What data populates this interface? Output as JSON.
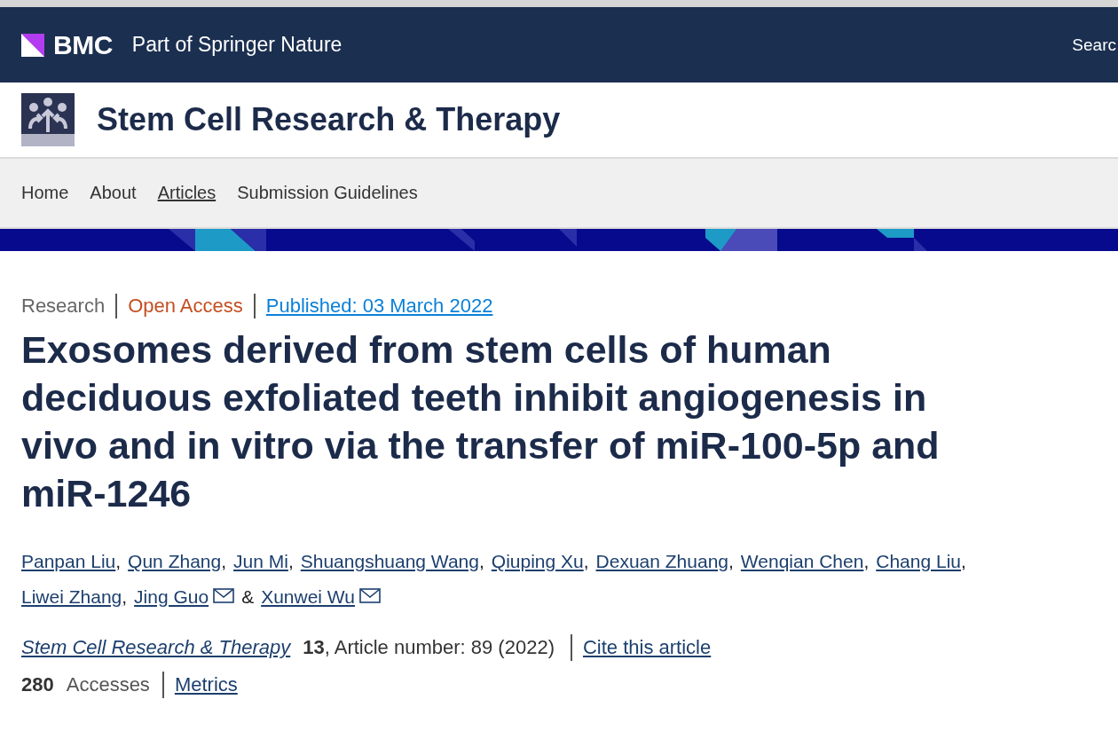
{
  "header": {
    "brand": "BMC",
    "tagline": "Part of Springer Nature",
    "search": "Searc"
  },
  "journal": {
    "title": "Stem Cell Research & Therapy"
  },
  "nav": [
    {
      "label": "Home",
      "selected": false
    },
    {
      "label": "About",
      "selected": false
    },
    {
      "label": "Articles",
      "selected": true
    },
    {
      "label": "Submission Guidelines",
      "selected": false
    }
  ],
  "article": {
    "type": "Research",
    "access": "Open Access",
    "published": "Published: 03 March 2022",
    "title": "Exosomes derived from stem cells of human deciduous exfoliated teeth inhibit angiogenesis in vivo and in vitro via the transfer of miR-100-5p and miR-1246",
    "authors": [
      {
        "name": "Panpan Liu",
        "email": false,
        "sep": ","
      },
      {
        "name": "Qun Zhang",
        "email": false,
        "sep": ","
      },
      {
        "name": "Jun Mi",
        "email": false,
        "sep": ","
      },
      {
        "name": "Shuangshuang Wang",
        "email": false,
        "sep": ","
      },
      {
        "name": "Qiuping Xu",
        "email": false,
        "sep": ","
      },
      {
        "name": "Dexuan Zhuang",
        "email": false,
        "sep": ","
      },
      {
        "name": "Wenqian Chen",
        "email": false,
        "sep": ","
      },
      {
        "name": "Chang Liu",
        "email": false,
        "sep": ","
      },
      {
        "name": "Liwei Zhang",
        "email": false,
        "sep": ","
      },
      {
        "name": "Jing Guo",
        "email": true,
        "sep": "&"
      },
      {
        "name": "Xunwei Wu",
        "email": true
      }
    ],
    "journal_link": "Stem Cell Research & Therapy",
    "volume": "13",
    "article_number": ", Article number: 89 (2022)",
    "cite": "Cite this article",
    "accesses_count": "280",
    "accesses_label": "Accesses",
    "metrics": "Metrics"
  }
}
